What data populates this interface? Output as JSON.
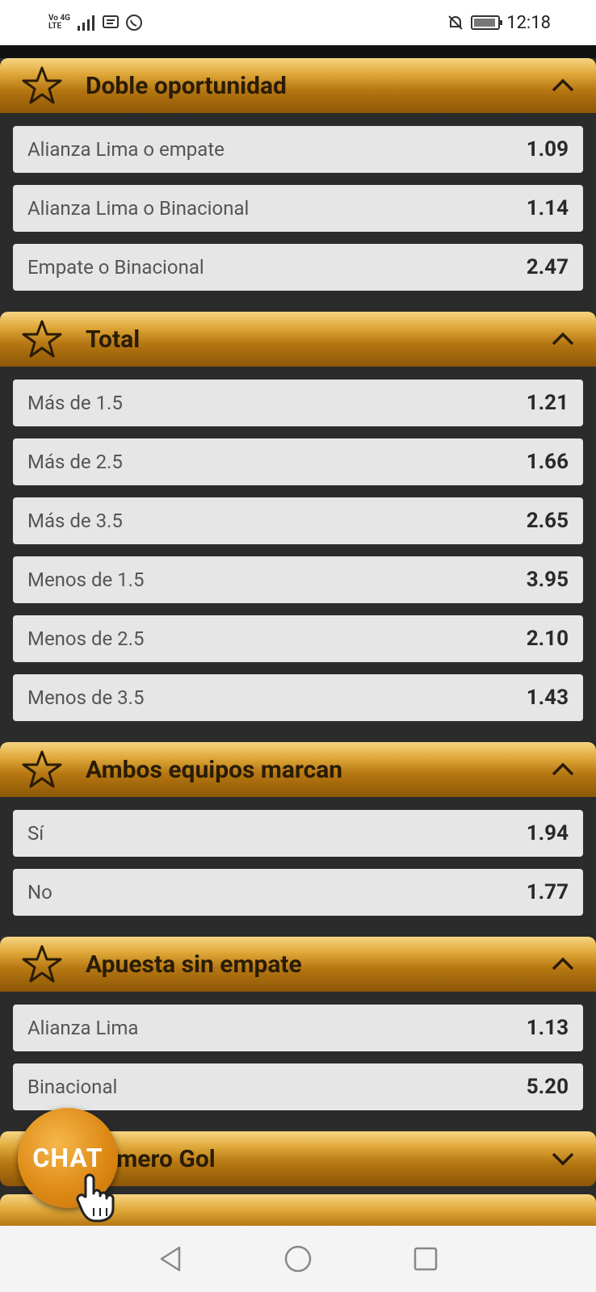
{
  "status": {
    "network_top": "Vo 4G",
    "network_bottom": "LTE",
    "time": "12:18"
  },
  "sections": [
    {
      "title": "Doble oportunidad",
      "expanded": true,
      "rows": [
        {
          "label": "Alianza Lima o empate",
          "odd": "1.09"
        },
        {
          "label": "Alianza Lima o Binacional",
          "odd": "1.14"
        },
        {
          "label": "Empate o Binacional",
          "odd": "2.47"
        }
      ]
    },
    {
      "title": "Total",
      "expanded": true,
      "rows": [
        {
          "label": "Más de 1.5",
          "odd": "1.21"
        },
        {
          "label": "Más de 2.5",
          "odd": "1.66"
        },
        {
          "label": "Más de 3.5",
          "odd": "2.65"
        },
        {
          "label": "Menos de 1.5",
          "odd": "3.95"
        },
        {
          "label": "Menos de 2.5",
          "odd": "2.10"
        },
        {
          "label": "Menos de 3.5",
          "odd": "1.43"
        }
      ]
    },
    {
      "title": "Ambos equipos marcan",
      "expanded": true,
      "rows": [
        {
          "label": "Sí",
          "odd": "1.94"
        },
        {
          "label": "No",
          "odd": "1.77"
        }
      ]
    },
    {
      "title": "Apuesta sin empate",
      "expanded": true,
      "rows": [
        {
          "label": "Alianza Lima",
          "odd": "1.13"
        },
        {
          "label": "Binacional",
          "odd": "5.20"
        }
      ]
    },
    {
      "title": "Primero Gol",
      "expanded": false,
      "rows": []
    }
  ],
  "chat_label": "CHAT",
  "colors": {
    "header_gold": "#c98a20",
    "row_bg": "#e6e6e6",
    "page_bg": "#2b2b2b",
    "chat_orange": "#de8a16"
  }
}
